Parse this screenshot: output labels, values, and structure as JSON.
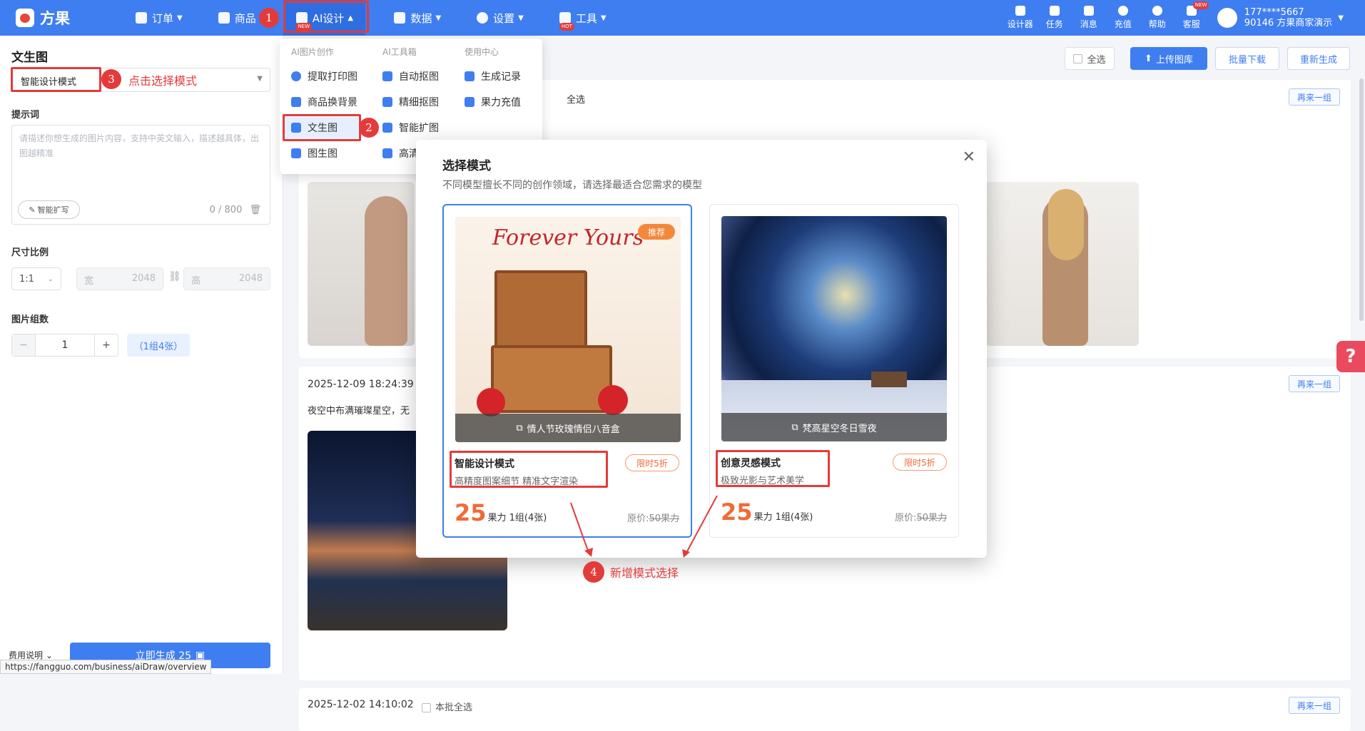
{
  "app": {
    "name": "方果"
  },
  "nav": {
    "items": [
      {
        "label": "订单"
      },
      {
        "label": "商品"
      },
      {
        "label": "AI设计"
      },
      {
        "label": "数据"
      },
      {
        "label": "设置"
      },
      {
        "label": "工具"
      }
    ],
    "badge_new": "NEW",
    "badge_hot": "HOT"
  },
  "tools": [
    {
      "label": "设计器"
    },
    {
      "label": "任务"
    },
    {
      "label": "消息"
    },
    {
      "label": "充值"
    },
    {
      "label": "帮助"
    },
    {
      "label": "客服"
    }
  ],
  "user": {
    "phone": "177****5667",
    "shop": "90146 方果商家演示"
  },
  "dropdown": {
    "headers": [
      "AI图片创作",
      "AI工具箱",
      "使用中心"
    ],
    "col1": [
      "提取打印图",
      "商品换背景",
      "文生图",
      "图生图"
    ],
    "col2": [
      "自动抠图",
      "精细抠图",
      "智能扩图",
      "高清"
    ],
    "col3": [
      "生成记录",
      "果力充值"
    ]
  },
  "left": {
    "title": "文生图",
    "mode_value": "智能设计模式",
    "mode_hint": "点击选择模式",
    "prompt_label": "提示词",
    "prompt_placeholder": "请描述你想生成的图片内容，支持中英文输入，描述越具体，出图越精准",
    "ai_expand": "智能扩写",
    "counter": "0 / 800",
    "size_label": "尺寸比例",
    "ratio": "1:1",
    "width_label": "宽",
    "width_val": "2048",
    "height_label": "高",
    "height_val": "2048",
    "count_label": "图片组数",
    "count_val": "1",
    "count_tag": "（1组4张）",
    "fee_label": "费用说明",
    "generate": "立即生成  25"
  },
  "toolbar": {
    "select_all": "全选",
    "upload": "上传图库",
    "batch_download": "批量下载",
    "regenerate": "重新生成"
  },
  "records": [
    {
      "again": "再来一组",
      "select_all": "全选"
    },
    {
      "datetime": "2025-12-09 18:24:39",
      "prompt": "夜空中布满璀璨星空，无",
      "again": "再来一组"
    },
    {
      "datetime": "2025-12-02 14:10:02",
      "batch_select": "本批全选",
      "again": "再来一组"
    }
  ],
  "modal": {
    "title": "选择模式",
    "subtitle": "不同模型擅长不同的创作领域，请选择最适合您需求的模型",
    "cards": [
      {
        "badge": "推荐",
        "img_title": "Forever Yours",
        "caption": "情人节玫瑰情侣八音盒",
        "name": "智能设计模式",
        "desc": "高精度图案细节 精准文字渲染",
        "discount": "限时5折",
        "price": "25",
        "price_unit": "果力 1组(4张)",
        "orig_label": "原价:",
        "orig_price": "50果力"
      },
      {
        "caption": "梵高星空冬日雪夜",
        "name": "创意灵感模式",
        "desc": "极致光影与艺术美学",
        "discount": "限时5折",
        "price": "25",
        "price_unit": "果力 1组(4张)",
        "orig_label": "原价:",
        "orig_price": "50果力"
      }
    ]
  },
  "annotations": {
    "n1": "1",
    "n2": "2",
    "n3": "3",
    "n4": "4",
    "n4_text": "新增模式选择"
  },
  "status_url": "https://fangguo.com/business/aiDraw/overview",
  "help_float": "?",
  "colors": {
    "primary": "#3f7ef0",
    "accent_red": "#e33b3b",
    "price_orange": "#f06a35"
  }
}
